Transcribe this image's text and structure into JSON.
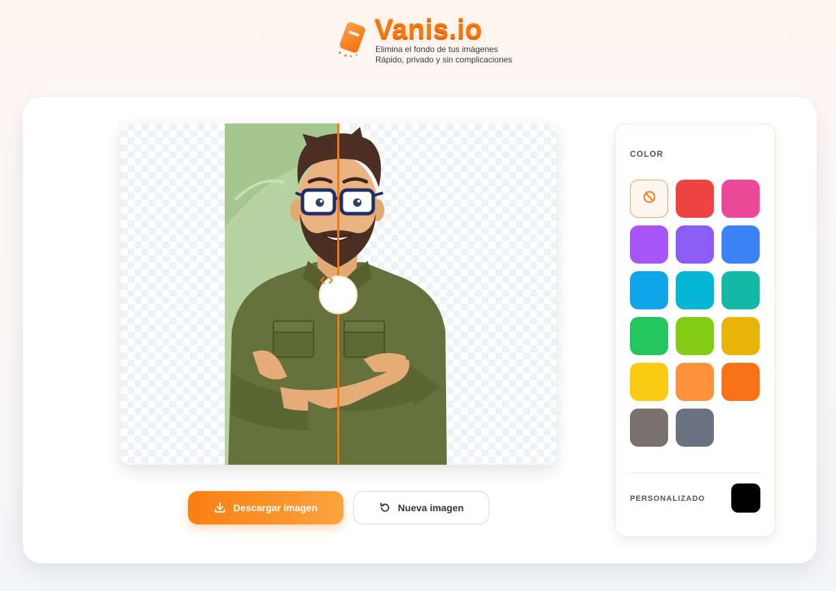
{
  "header": {
    "brand": "Vanis.io",
    "tagline_1": "Elimina el fondo de tus imágenes",
    "tagline_2": "Rápido, privado y sin complicaciones",
    "logo_icon": "eraser-icon"
  },
  "preview": {
    "slider_handle_icon": "chevron-left-right-icon",
    "slider_position_percent": 50
  },
  "actions": {
    "download_label": "Descargar imagen",
    "download_icon": "download-icon",
    "new_label": "Nueva imagen",
    "new_icon": "refresh-icon"
  },
  "color_panel": {
    "title": "COLOR",
    "none_icon": "no-color-icon",
    "swatches": [
      {
        "name": "none",
        "color": null
      },
      {
        "name": "red",
        "color": "#ef4444"
      },
      {
        "name": "pink",
        "color": "#ec4899"
      },
      {
        "name": "purple",
        "color": "#a855f7"
      },
      {
        "name": "violet",
        "color": "#8b5cf6"
      },
      {
        "name": "blue",
        "color": "#3b82f6"
      },
      {
        "name": "sky",
        "color": "#0ea5e9"
      },
      {
        "name": "cyan",
        "color": "#06b6d4"
      },
      {
        "name": "teal",
        "color": "#14b8a6"
      },
      {
        "name": "green",
        "color": "#22c55e"
      },
      {
        "name": "lime",
        "color": "#84cc16"
      },
      {
        "name": "amber",
        "color": "#eab308"
      },
      {
        "name": "yellow",
        "color": "#facc15"
      },
      {
        "name": "orange-light",
        "color": "#fb923c"
      },
      {
        "name": "orange",
        "color": "#f97316"
      },
      {
        "name": "stone",
        "color": "#78716c"
      },
      {
        "name": "slate",
        "color": "#6b7280"
      }
    ],
    "selected": "none",
    "custom_label": "PERSONALIZADO",
    "custom_color": "#000000"
  },
  "colors": {
    "accent": "#f7780f",
    "accent_light": "#fca33f"
  }
}
